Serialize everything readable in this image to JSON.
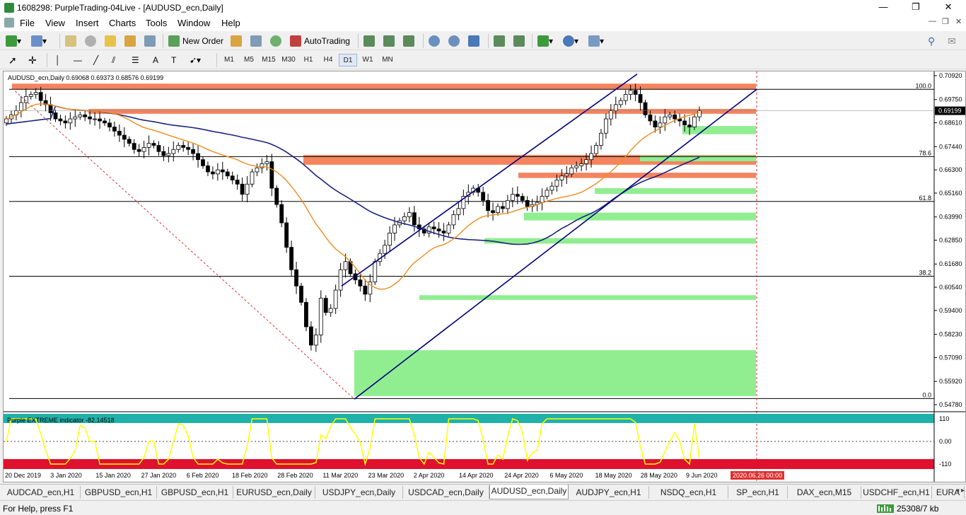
{
  "window": {
    "title": "1608298: PurpleTrading-04Live - [AUDUSD_ecn,Daily]",
    "minimize": "—",
    "restore": "❐",
    "close": "✕"
  },
  "menu": [
    "File",
    "View",
    "Insert",
    "Charts",
    "Tools",
    "Window",
    "Help"
  ],
  "toolbar": {
    "new_order": "New Order",
    "autotrading": "AutoTrading",
    "timeframes": [
      "M1",
      "M5",
      "M15",
      "M30",
      "H1",
      "H4",
      "D1",
      "W1",
      "MN"
    ],
    "active_timeframe": "D1"
  },
  "chart": {
    "header": "AUDUSD_ecn,Daily  0.69068 0.69373 0.68576 0.69199",
    "current_price": "0.69199",
    "indicator_label": "Purple EXTREME indicator -82.14518",
    "date_tooltip": "2020.06.26 00:00",
    "colors": {
      "bull": "#ffffff",
      "bear": "#000000",
      "zone_supply": "#f4845f",
      "zone_demand": "#90ee90",
      "ma_slow": "#1a237e",
      "ma_fast": "#ef8c1c",
      "indicator": "#ffff00",
      "ind_top": "#20b2aa",
      "ind_bottom": "#e0102f"
    }
  },
  "chart_data": {
    "type": "candlestick",
    "symbol": "AUDUSD_ecn",
    "timeframe": "Daily",
    "ylim": [
      0.5478,
      0.7092
    ],
    "y_ticks": [
      "0.70920",
      "0.69750",
      "0.68610",
      "0.67440",
      "0.66300",
      "0.65160",
      "0.63990",
      "0.62850",
      "0.61680",
      "0.60540",
      "0.59400",
      "0.58230",
      "0.57090",
      "0.55920",
      "0.54780"
    ],
    "x_ticks": [
      "20 Dec 2019",
      "3 Jan 2020",
      "15 Jan 2020",
      "27 Jan 2020",
      "6 Feb 2020",
      "18 Feb 2020",
      "28 Feb 2020",
      "11 Mar 2020",
      "23 Mar 2020",
      "2 Apr 2020",
      "14 Apr 2020",
      "24 Apr 2020",
      "6 May 2020",
      "18 May 2020",
      "28 May 2020",
      "9 Jun 2020"
    ],
    "fibo_levels": [
      {
        "label": "100.0",
        "price": 0.7025
      },
      {
        "label": "78.6",
        "price": 0.6695
      },
      {
        "label": "61.8",
        "price": 0.6475
      },
      {
        "label": "38.2",
        "price": 0.6108
      },
      {
        "label": "0.0",
        "price": 0.5508
      }
    ],
    "indicator_ticks": [
      "110",
      "0.00",
      "-110"
    ],
    "indicator_value": -82.14518,
    "closes": [
      0.688,
      0.69,
      0.692,
      0.696,
      0.699,
      0.7,
      0.701,
      0.697,
      0.695,
      0.691,
      0.688,
      0.687,
      0.686,
      0.688,
      0.689,
      0.69,
      0.689,
      0.688,
      0.688,
      0.687,
      0.686,
      0.684,
      0.682,
      0.68,
      0.678,
      0.676,
      0.673,
      0.672,
      0.674,
      0.676,
      0.675,
      0.672,
      0.67,
      0.671,
      0.673,
      0.675,
      0.674,
      0.673,
      0.671,
      0.668,
      0.665,
      0.662,
      0.661,
      0.663,
      0.662,
      0.66,
      0.658,
      0.656,
      0.651,
      0.656,
      0.662,
      0.664,
      0.666,
      0.667,
      0.654,
      0.646,
      0.637,
      0.625,
      0.614,
      0.606,
      0.598,
      0.586,
      0.577,
      0.582,
      0.6,
      0.593,
      0.595,
      0.604,
      0.614,
      0.618,
      0.612,
      0.609,
      0.606,
      0.602,
      0.608,
      0.618,
      0.622,
      0.626,
      0.632,
      0.636,
      0.638,
      0.64,
      0.642,
      0.636,
      0.634,
      0.632,
      0.635,
      0.634,
      0.633,
      0.632,
      0.636,
      0.641,
      0.644,
      0.65,
      0.652,
      0.654,
      0.652,
      0.648,
      0.643,
      0.642,
      0.645,
      0.644,
      0.648,
      0.651,
      0.65,
      0.648,
      0.645,
      0.646,
      0.647,
      0.65,
      0.653,
      0.655,
      0.658,
      0.66,
      0.661,
      0.664,
      0.665,
      0.666,
      0.668,
      0.671,
      0.675,
      0.681,
      0.688,
      0.692,
      0.695,
      0.697,
      0.7,
      0.702,
      0.7,
      0.696,
      0.69,
      0.687,
      0.684,
      0.686,
      0.689,
      0.69,
      0.688,
      0.687,
      0.685,
      0.684,
      0.689,
      0.692
    ]
  },
  "tabs": [
    "AUDCAD_ecn,H1",
    "GBPUSD_ecn,H1",
    "GBPUSD_ecn,H1",
    "EURUSD_ecn,Daily",
    "USDJPY_ecn,Daily",
    "USDCAD_ecn,Daily",
    "AUDUSD_ecn,Daily",
    "AUDJPY_ecn,H1",
    "NSDQ_ecn,H1",
    "SP_ecn,H1",
    "DAX_ecn,M15",
    "USDCHF_ecn,H1",
    "EURA"
  ],
  "active_tab": "AUDUSD_ecn,Daily",
  "status": {
    "help": "For Help, press F1",
    "traffic": "25308/7 kb"
  }
}
